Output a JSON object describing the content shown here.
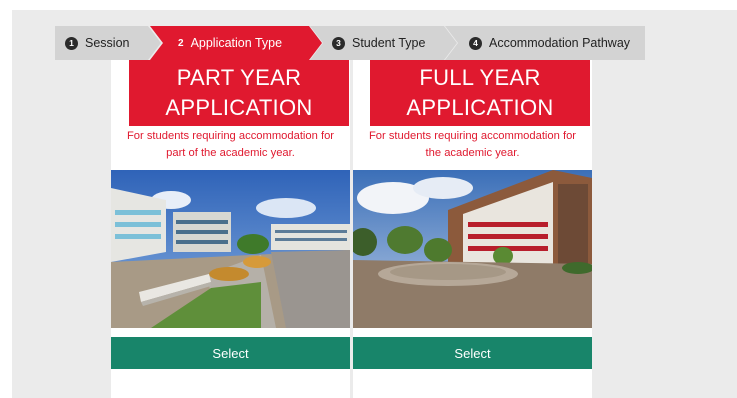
{
  "stepper": {
    "steps": [
      {
        "number": "1",
        "label": "Session",
        "state": "completed"
      },
      {
        "number": "2",
        "label": "Application Type",
        "state": "active"
      },
      {
        "number": "3",
        "label": "Student Type",
        "state": "pending"
      },
      {
        "number": "4",
        "label": "Accommodation Pathway",
        "state": "pending"
      }
    ],
    "active_color": "#e0192f",
    "inactive_color": "#d3d3d3"
  },
  "cards": [
    {
      "title_line1": "PART YEAR",
      "title_line2": "APPLICATION",
      "description_line1": "For students requiring accommodation for",
      "description_line2": "part of the academic year.",
      "photo": "campus-courtyard-photo",
      "select_label": "Select"
    },
    {
      "title_line1": "FULL YEAR",
      "title_line2": "APPLICATION",
      "description_line1": "For students requiring accommodation for",
      "description_line2": "the academic year.",
      "photo": "residence-plaza-photo",
      "select_label": "Select"
    }
  ],
  "colors": {
    "brand_red": "#e0192f",
    "select_green": "#18856a",
    "page_grey": "#ebebeb"
  }
}
